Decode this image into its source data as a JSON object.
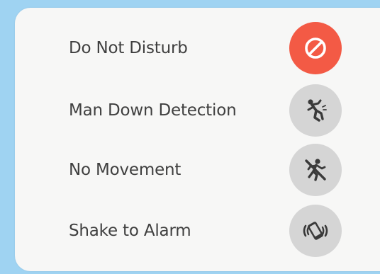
{
  "colors": {
    "background": "#9fd3f2",
    "panel": "#f7f7f6",
    "active": "#f35a45",
    "inactive": "#d5d5d5",
    "icon_inactive": "#3a3a3a",
    "icon_active": "#ffffff",
    "text": "#3f3f3f"
  },
  "settings": [
    {
      "label": "Do Not Disturb",
      "icon": "do-not-disturb-icon",
      "active": true
    },
    {
      "label": "Man Down Detection",
      "icon": "falling-person-icon",
      "active": false
    },
    {
      "label": "No Movement",
      "icon": "no-movement-icon",
      "active": false
    },
    {
      "label": "Shake to Alarm",
      "icon": "shake-phone-icon",
      "active": false
    }
  ]
}
